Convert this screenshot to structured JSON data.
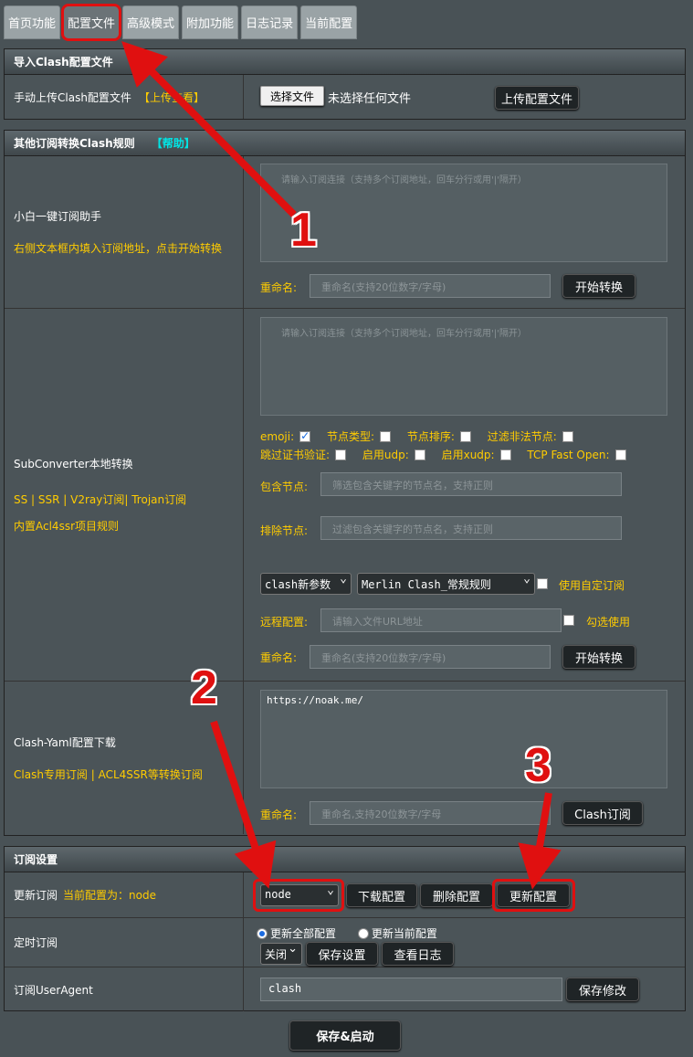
{
  "tabs": [
    "首页功能",
    "配置文件",
    "高级模式",
    "附加功能",
    "日志记录",
    "当前配置"
  ],
  "import_section": {
    "title": "导入Clash配置文件",
    "label": "手动上传Clash配置文件",
    "link": "【上传查看】",
    "choose_button": "选择文件",
    "no_file": "未选择任何文件",
    "upload_button": "上传配置文件"
  },
  "convert_section": {
    "title": "其他订阅转换Clash规则",
    "help": "【帮助】",
    "assistant": {
      "label": "小白一键订阅助手",
      "hint": "右侧文本框内填入订阅地址，点击开始转换",
      "textarea_placeholder": "请输入订阅连接（支持多个订阅地址，回车分行或用'|'隔开）",
      "rename_label": "重命名:",
      "rename_placeholder": "重命名(支持20位数字/字母)",
      "start_button": "开始转换"
    },
    "subconverter": {
      "label": "SubConverter本地转换",
      "hint1": "SS | SSR | V2ray订阅| Trojan订阅",
      "hint2": "内置Acl4ssr项目规则",
      "textarea_placeholder": "请输入订阅连接（支持多个订阅地址，回车分行或用'|'隔开）",
      "opt_emoji": "emoji:",
      "opt_node_type": "节点类型:",
      "opt_node_sort": "节点排序:",
      "opt_filter": "过滤非法节点:",
      "opt_skip_cert": "跳过证书验证:",
      "opt_udp": "启用udp:",
      "opt_xudp": "启用xudp:",
      "opt_tfo": "TCP Fast Open:",
      "include_label": "包含节点:",
      "include_placeholder": "筛选包含关键字的节点名，支持正则",
      "exclude_label": "排除节点:",
      "exclude_placeholder": "过滤包含关键字的节点名，支持正则",
      "param_select": "clash新参数",
      "rule_select": "Merlin Clash_常规规则",
      "custom_sub": "使用自定订阅",
      "remote_label": "远程配置:",
      "remote_placeholder": "请输入文件URL地址",
      "tick_use": "勾选使用",
      "rename_label": "重命名:",
      "rename_placeholder": "重命名(支持20位数字/字母)",
      "start_button": "开始转换"
    },
    "yaml": {
      "label": "Clash-Yaml配置下载",
      "hint": "Clash专用订阅 | ACL4SSR等转换订阅",
      "textarea_value": "https://noak.me/",
      "rename_label": "重命名:",
      "rename_placeholder": "重命名,支持20位数字/字母",
      "button": "Clash订阅"
    }
  },
  "sub_section": {
    "title": "订阅设置",
    "update_label": "更新订阅",
    "current_label": "当前配置为：node",
    "config_select": "node",
    "download_button": "下载配置",
    "delete_button": "删除配置",
    "update_button": "更新配置",
    "timer_label": "定时订阅",
    "radio_all": "更新全部配置",
    "radio_current": "更新当前配置",
    "timer_select": "关闭",
    "save_settings": "保存设置",
    "view_log": "查看日志",
    "ua_label": "订阅UserAgent",
    "ua_value": "clash",
    "save_ua": "保存修改"
  },
  "save_start": "保存&启动",
  "annotations": [
    "1",
    "2",
    "3"
  ],
  "colors": {
    "accent_yellow": "#ffcc00",
    "help_cyan": "#00e5e5",
    "annotation_red": "#e01010"
  }
}
